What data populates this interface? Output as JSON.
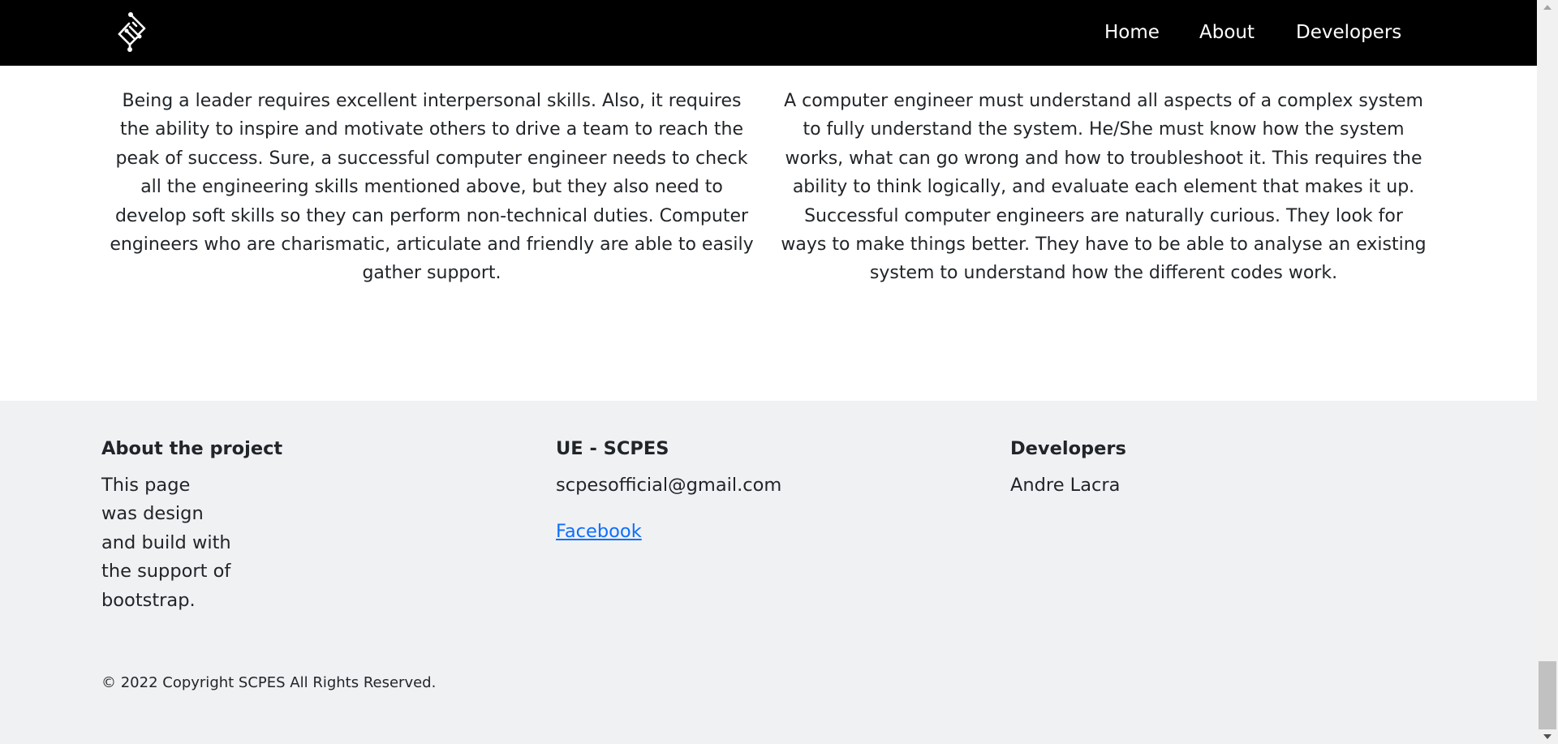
{
  "navbar": {
    "logo_icon": "circuit-diamond-logo-icon",
    "links": [
      {
        "label": "Home"
      },
      {
        "label": "About"
      },
      {
        "label": "Developers"
      }
    ]
  },
  "main": {
    "paragraphs": [
      "Being a leader requires excellent interpersonal skills. Also, it requires the ability to inspire and motivate others to drive a team to reach the peak of success. Sure, a successful computer engineer needs to check all the engineering skills mentioned above, but they also need to develop soft skills so they can perform non-technical duties. Computer engineers who are charismatic, articulate and friendly are able to easily gather support.",
      "A computer engineer must understand all aspects of a complex system to fully understand the system. He/She must know how the system works, what can go wrong and how to troubleshoot it. This requires the ability to think logically, and evaluate each element that makes it up. Successful computer engineers are naturally curious. They look for ways to make things better. They have to be able to analyse an existing system to understand how the different codes work."
    ]
  },
  "footer": {
    "about": {
      "heading": "About the project",
      "text": "This page was design and build with the support of bootstrap."
    },
    "contact": {
      "heading": "UE - SCPES",
      "email": "scpesofficial@gmail.com",
      "facebook_label": "Facebook"
    },
    "developers": {
      "heading": "Developers",
      "name": "Andre Lacra"
    },
    "copyright": "© 2022 Copyright SCPES All Rights Reserved."
  },
  "colors": {
    "navbar_bg": "#000000",
    "footer_bg": "#f0f1f3",
    "link": "#0d6efd"
  }
}
